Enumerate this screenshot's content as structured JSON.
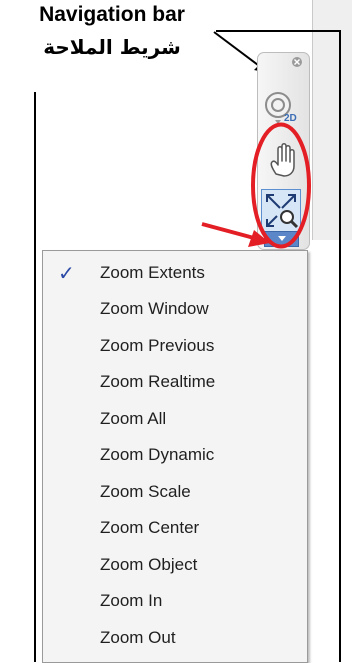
{
  "annotation": {
    "title_en": "Navigation bar",
    "title_ar": "شريط الملاحة"
  },
  "colors": {
    "highlight": "#e31e24",
    "check": "#2b4aa6",
    "zoom_tool_bg": "#d6e6f6",
    "flyout_button": "#5b87c9"
  },
  "nav_bar": {
    "tools": [
      {
        "icon": "steering-wheel-2d-icon",
        "label": "2D"
      },
      {
        "icon": "pan-hand-icon"
      },
      {
        "icon": "zoom-extents-icon",
        "active": true
      }
    ]
  },
  "menu": {
    "selected": "Zoom Extents",
    "items": [
      {
        "label": "Zoom Extents",
        "checked": true
      },
      {
        "label": "Zoom Window",
        "checked": false
      },
      {
        "label": "Zoom Previous",
        "checked": false
      },
      {
        "label": "Zoom Realtime",
        "checked": false
      },
      {
        "label": "Zoom All",
        "checked": false
      },
      {
        "label": "Zoom Dynamic",
        "checked": false
      },
      {
        "label": "Zoom Scale",
        "checked": false
      },
      {
        "label": "Zoom Center",
        "checked": false
      },
      {
        "label": "Zoom Object",
        "checked": false
      },
      {
        "label": "Zoom In",
        "checked": false
      },
      {
        "label": "Zoom Out",
        "checked": false
      }
    ]
  },
  "icons": {
    "check": "✓"
  }
}
